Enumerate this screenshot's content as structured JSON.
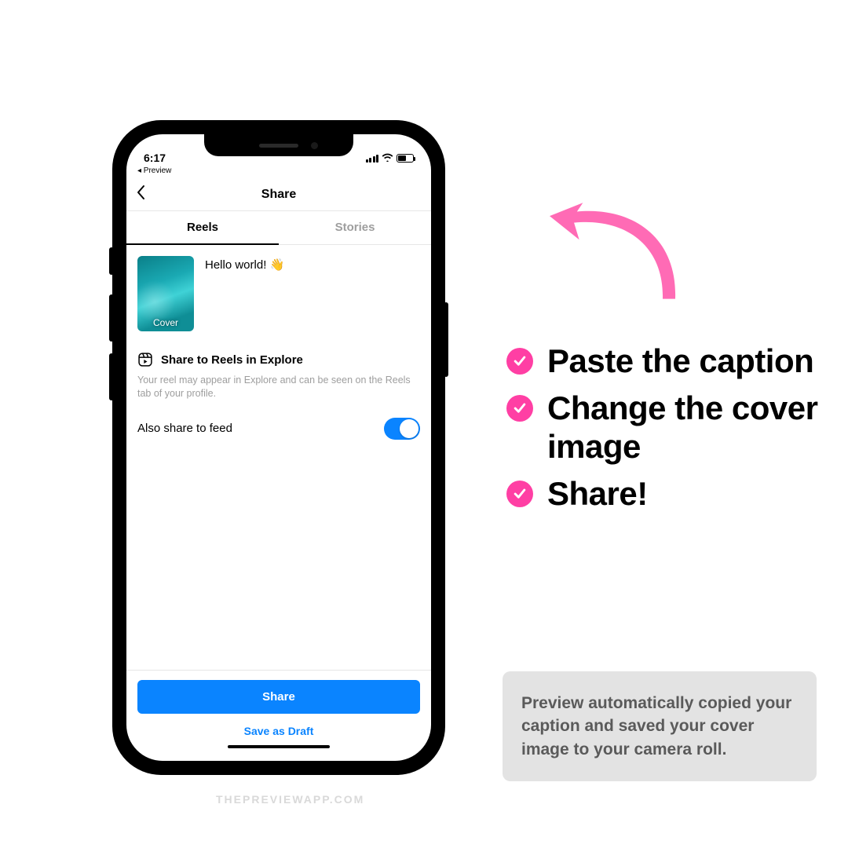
{
  "status": {
    "time": "6:17",
    "breadcrumb": "◂ Preview"
  },
  "nav": {
    "title": "Share"
  },
  "tabs": {
    "reels": "Reels",
    "stories": "Stories"
  },
  "compose": {
    "cover_label": "Cover",
    "caption": "Hello world! 👋"
  },
  "explore": {
    "title": "Share to Reels in Explore",
    "desc": "Your reel may appear in Explore and can be seen on the Reels tab of your profile."
  },
  "feed_toggle": {
    "label": "Also share to feed"
  },
  "actions": {
    "share": "Share",
    "draft": "Save as Draft"
  },
  "checklist": {
    "item1": "Paste the caption",
    "item2": "Change the cover image",
    "item3": "Share!"
  },
  "info": {
    "text": "Preview automatically copied your caption and saved your cover image to your camera roll."
  },
  "watermark": "THEPREVIEWAPP.COM",
  "colors": {
    "pink": "#ff3fa4",
    "blue": "#0a84ff"
  }
}
